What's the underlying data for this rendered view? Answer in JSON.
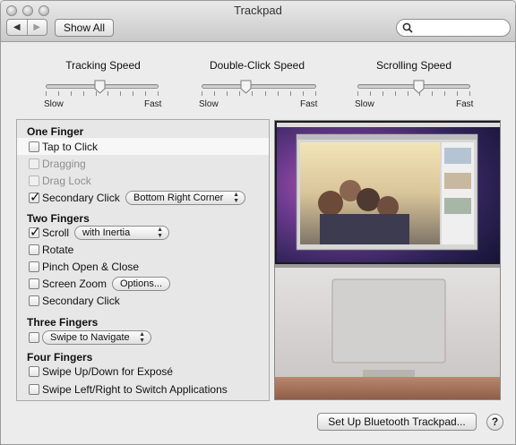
{
  "window": {
    "title": "Trackpad",
    "show_all_label": "Show All",
    "back_glyph": "◀",
    "forward_glyph": "▶",
    "search": {
      "value": "",
      "placeholder": ""
    }
  },
  "speeds": {
    "tracking": {
      "label": "Tracking Speed",
      "min_label": "Slow",
      "max_label": "Fast",
      "value": 0.48
    },
    "double_click": {
      "label": "Double-Click Speed",
      "min_label": "Slow",
      "max_label": "Fast",
      "value": 0.39
    },
    "scrolling": {
      "label": "Scrolling Speed",
      "min_label": "Slow",
      "max_label": "Fast",
      "value": 0.54
    }
  },
  "gestures": {
    "one_finger": {
      "heading": "One Finger",
      "tap_to_click": {
        "label": "Tap to Click",
        "checked": false,
        "enabled": true
      },
      "dragging": {
        "label": "Dragging",
        "checked": false,
        "enabled": false
      },
      "drag_lock": {
        "label": "Drag Lock",
        "checked": false,
        "enabled": false
      },
      "secondary_click": {
        "label": "Secondary Click",
        "checked": true,
        "enabled": true,
        "popup": "Bottom Right Corner"
      }
    },
    "two_fingers": {
      "heading": "Two Fingers",
      "scroll": {
        "label": "Scroll",
        "checked": true,
        "popup": "with Inertia"
      },
      "rotate": {
        "label": "Rotate",
        "checked": false
      },
      "pinch": {
        "label": "Pinch Open & Close",
        "checked": false
      },
      "screen_zoom": {
        "label": "Screen Zoom",
        "checked": false,
        "options_label": "Options..."
      },
      "secondary_click": {
        "label": "Secondary Click",
        "checked": false
      }
    },
    "three_fingers": {
      "heading": "Three Fingers",
      "swipe": {
        "checked": false,
        "popup": "Swipe to Navigate"
      }
    },
    "four_fingers": {
      "heading": "Four Fingers",
      "swipe_expose": {
        "label": "Swipe Up/Down for Exposé",
        "checked": false
      },
      "swipe_switch": {
        "label": "Swipe Left/Right to Switch Applications",
        "checked": false
      }
    }
  },
  "footer": {
    "bluetooth_label": "Set Up Bluetooth Trackpad...",
    "help_label": "?"
  },
  "colors": {
    "selected_row": "#f7f7f7",
    "desktop_purple": "#4a2b6b"
  }
}
